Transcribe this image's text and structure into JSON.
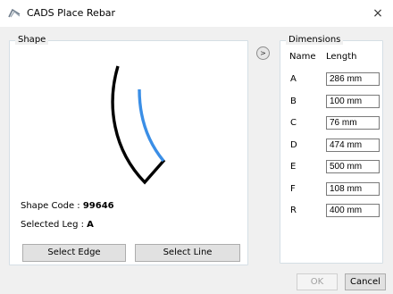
{
  "window": {
    "title": "CADS Place Rebar",
    "close_glyph": "×",
    "app_icon": "cads-rebar-icon"
  },
  "shape_panel": {
    "legend": "Shape",
    "shape_code_label": "Shape Code : ",
    "shape_code_value": "99646",
    "selected_leg_label": "Selected Leg : ",
    "selected_leg_value": "A",
    "select_edge_label": "Select Edge",
    "select_line_label": "Select Line",
    "colors": {
      "shape_stroke": "#000000",
      "selected_leg": "#3a8ee6"
    }
  },
  "arrow_button": {
    "label": ">"
  },
  "dimensions_panel": {
    "legend": "Dimensions",
    "header_name": "Name",
    "header_length": "Length",
    "rows": [
      {
        "name": "A",
        "length": "286 mm"
      },
      {
        "name": "B",
        "length": "100 mm"
      },
      {
        "name": "C",
        "length": "76 mm"
      },
      {
        "name": "D",
        "length": "474 mm"
      },
      {
        "name": "E",
        "length": "500 mm"
      },
      {
        "name": "F",
        "length": "108 mm"
      },
      {
        "name": "R",
        "length": "400 mm"
      }
    ]
  },
  "footer": {
    "ok_label": "OK",
    "cancel_label": "Cancel"
  }
}
